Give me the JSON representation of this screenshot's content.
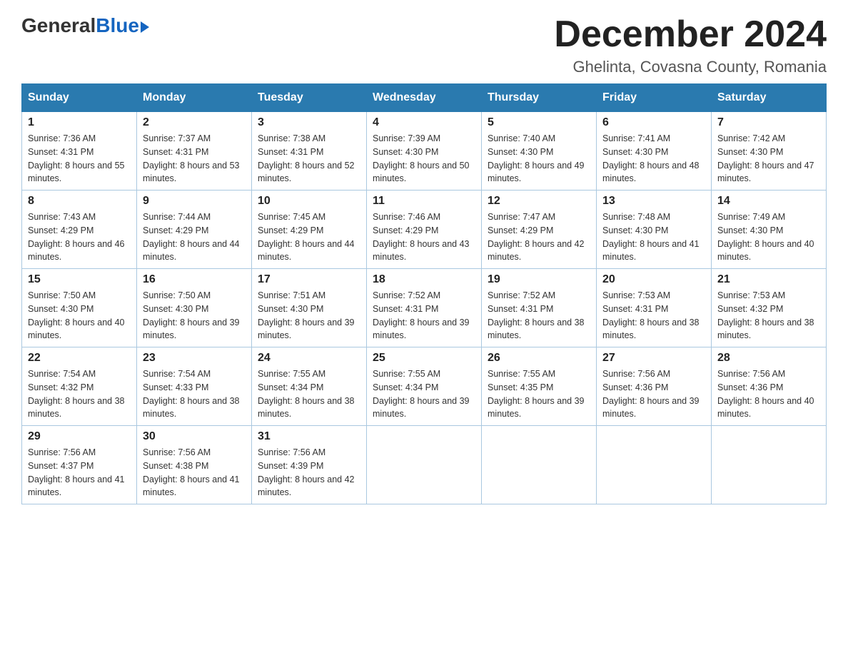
{
  "header": {
    "logo": {
      "general": "General",
      "blue": "Blue"
    },
    "title": "December 2024",
    "location": "Ghelinta, Covasna County, Romania"
  },
  "weekdays": [
    "Sunday",
    "Monday",
    "Tuesday",
    "Wednesday",
    "Thursday",
    "Friday",
    "Saturday"
  ],
  "weeks": [
    [
      {
        "day": "1",
        "sunrise": "7:36 AM",
        "sunset": "4:31 PM",
        "daylight": "8 hours and 55 minutes."
      },
      {
        "day": "2",
        "sunrise": "7:37 AM",
        "sunset": "4:31 PM",
        "daylight": "8 hours and 53 minutes."
      },
      {
        "day": "3",
        "sunrise": "7:38 AM",
        "sunset": "4:31 PM",
        "daylight": "8 hours and 52 minutes."
      },
      {
        "day": "4",
        "sunrise": "7:39 AM",
        "sunset": "4:30 PM",
        "daylight": "8 hours and 50 minutes."
      },
      {
        "day": "5",
        "sunrise": "7:40 AM",
        "sunset": "4:30 PM",
        "daylight": "8 hours and 49 minutes."
      },
      {
        "day": "6",
        "sunrise": "7:41 AM",
        "sunset": "4:30 PM",
        "daylight": "8 hours and 48 minutes."
      },
      {
        "day": "7",
        "sunrise": "7:42 AM",
        "sunset": "4:30 PM",
        "daylight": "8 hours and 47 minutes."
      }
    ],
    [
      {
        "day": "8",
        "sunrise": "7:43 AM",
        "sunset": "4:29 PM",
        "daylight": "8 hours and 46 minutes."
      },
      {
        "day": "9",
        "sunrise": "7:44 AM",
        "sunset": "4:29 PM",
        "daylight": "8 hours and 44 minutes."
      },
      {
        "day": "10",
        "sunrise": "7:45 AM",
        "sunset": "4:29 PM",
        "daylight": "8 hours and 44 minutes."
      },
      {
        "day": "11",
        "sunrise": "7:46 AM",
        "sunset": "4:29 PM",
        "daylight": "8 hours and 43 minutes."
      },
      {
        "day": "12",
        "sunrise": "7:47 AM",
        "sunset": "4:29 PM",
        "daylight": "8 hours and 42 minutes."
      },
      {
        "day": "13",
        "sunrise": "7:48 AM",
        "sunset": "4:30 PM",
        "daylight": "8 hours and 41 minutes."
      },
      {
        "day": "14",
        "sunrise": "7:49 AM",
        "sunset": "4:30 PM",
        "daylight": "8 hours and 40 minutes."
      }
    ],
    [
      {
        "day": "15",
        "sunrise": "7:50 AM",
        "sunset": "4:30 PM",
        "daylight": "8 hours and 40 minutes."
      },
      {
        "day": "16",
        "sunrise": "7:50 AM",
        "sunset": "4:30 PM",
        "daylight": "8 hours and 39 minutes."
      },
      {
        "day": "17",
        "sunrise": "7:51 AM",
        "sunset": "4:30 PM",
        "daylight": "8 hours and 39 minutes."
      },
      {
        "day": "18",
        "sunrise": "7:52 AM",
        "sunset": "4:31 PM",
        "daylight": "8 hours and 39 minutes."
      },
      {
        "day": "19",
        "sunrise": "7:52 AM",
        "sunset": "4:31 PM",
        "daylight": "8 hours and 38 minutes."
      },
      {
        "day": "20",
        "sunrise": "7:53 AM",
        "sunset": "4:31 PM",
        "daylight": "8 hours and 38 minutes."
      },
      {
        "day": "21",
        "sunrise": "7:53 AM",
        "sunset": "4:32 PM",
        "daylight": "8 hours and 38 minutes."
      }
    ],
    [
      {
        "day": "22",
        "sunrise": "7:54 AM",
        "sunset": "4:32 PM",
        "daylight": "8 hours and 38 minutes."
      },
      {
        "day": "23",
        "sunrise": "7:54 AM",
        "sunset": "4:33 PM",
        "daylight": "8 hours and 38 minutes."
      },
      {
        "day": "24",
        "sunrise": "7:55 AM",
        "sunset": "4:34 PM",
        "daylight": "8 hours and 38 minutes."
      },
      {
        "day": "25",
        "sunrise": "7:55 AM",
        "sunset": "4:34 PM",
        "daylight": "8 hours and 39 minutes."
      },
      {
        "day": "26",
        "sunrise": "7:55 AM",
        "sunset": "4:35 PM",
        "daylight": "8 hours and 39 minutes."
      },
      {
        "day": "27",
        "sunrise": "7:56 AM",
        "sunset": "4:36 PM",
        "daylight": "8 hours and 39 minutes."
      },
      {
        "day": "28",
        "sunrise": "7:56 AM",
        "sunset": "4:36 PM",
        "daylight": "8 hours and 40 minutes."
      }
    ],
    [
      {
        "day": "29",
        "sunrise": "7:56 AM",
        "sunset": "4:37 PM",
        "daylight": "8 hours and 41 minutes."
      },
      {
        "day": "30",
        "sunrise": "7:56 AM",
        "sunset": "4:38 PM",
        "daylight": "8 hours and 41 minutes."
      },
      {
        "day": "31",
        "sunrise": "7:56 AM",
        "sunset": "4:39 PM",
        "daylight": "8 hours and 42 minutes."
      },
      null,
      null,
      null,
      null
    ]
  ]
}
